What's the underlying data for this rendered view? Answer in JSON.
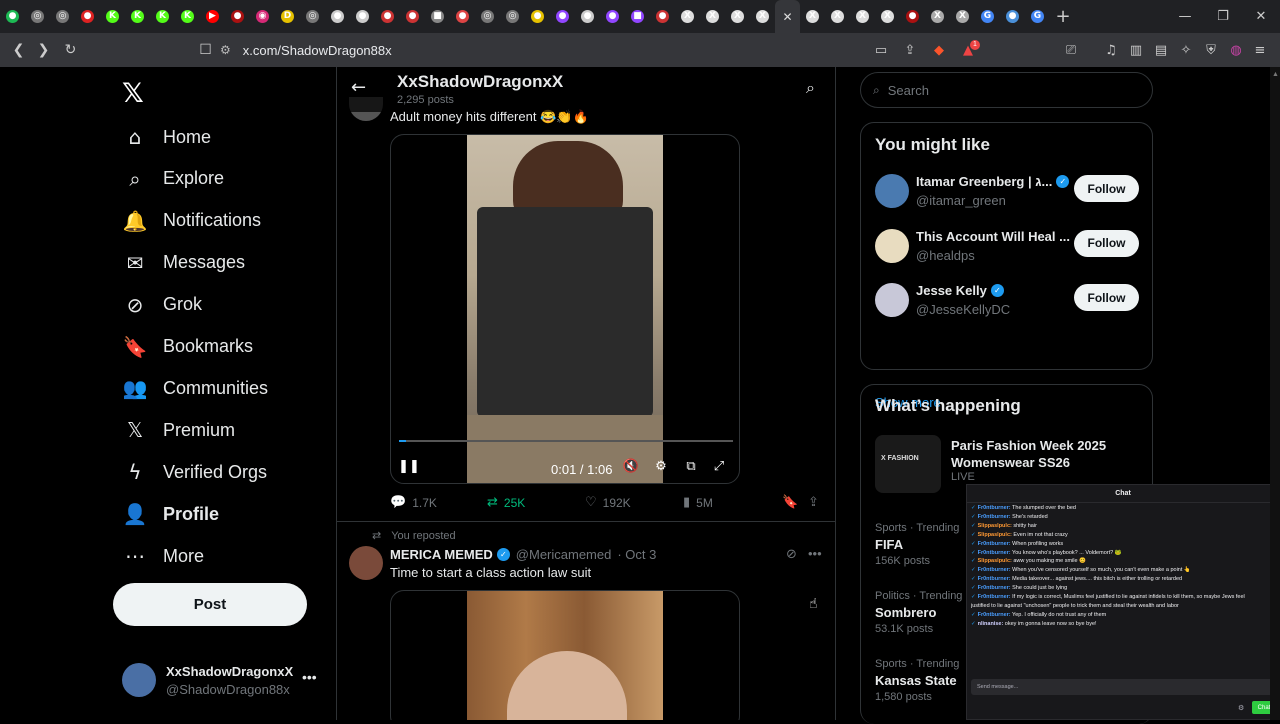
{
  "browser": {
    "tabs": [
      {
        "icon": "green-circle",
        "color": "#1db954",
        "glyph": "●"
      },
      {
        "icon": "grey-circle",
        "color": "#777",
        "glyph": "◎"
      },
      {
        "icon": "grey-circle",
        "color": "#777",
        "glyph": "◎"
      },
      {
        "icon": "red-circle",
        "color": "#d22",
        "glyph": "●"
      },
      {
        "icon": "kick-logo",
        "color": "#53fc18",
        "glyph": "K"
      },
      {
        "icon": "kick-logo",
        "color": "#53fc18",
        "glyph": "K"
      },
      {
        "icon": "kick-logo",
        "color": "#53fc18",
        "glyph": "K"
      },
      {
        "icon": "kick-logo",
        "color": "#53fc18",
        "glyph": "K"
      },
      {
        "icon": "youtube-logo",
        "color": "#f00",
        "glyph": "▶"
      },
      {
        "icon": "red-circle",
        "color": "#a11",
        "glyph": "●"
      },
      {
        "icon": "instagram-logo",
        "color": "#d62976",
        "glyph": "◉"
      },
      {
        "icon": "yellow-d-logo",
        "color": "#e5c100",
        "glyph": "D"
      },
      {
        "icon": "grey-circle",
        "color": "#777",
        "glyph": "◎"
      },
      {
        "icon": "white-circle",
        "color": "#ccc",
        "glyph": "●"
      },
      {
        "icon": "white-circle",
        "color": "#ccc",
        "glyph": "●"
      },
      {
        "icon": "red-circle",
        "color": "#c33",
        "glyph": "●"
      },
      {
        "icon": "red-circle",
        "color": "#c33",
        "glyph": "●"
      },
      {
        "icon": "grey-square",
        "color": "#888",
        "glyph": "■"
      },
      {
        "icon": "red-circle",
        "color": "#d44",
        "glyph": "●"
      },
      {
        "icon": "grey-circle",
        "color": "#777",
        "glyph": "◎"
      },
      {
        "icon": "grey-circle",
        "color": "#777",
        "glyph": "◎"
      },
      {
        "icon": "yellow-circle",
        "color": "#e5c100",
        "glyph": "●"
      },
      {
        "icon": "purple-circle",
        "color": "#9146ff",
        "glyph": "●"
      },
      {
        "icon": "white-circle",
        "color": "#ccc",
        "glyph": "●"
      },
      {
        "icon": "purple-circle",
        "color": "#9146ff",
        "glyph": "●"
      },
      {
        "icon": "twitch-logo",
        "color": "#9146ff",
        "glyph": "■"
      },
      {
        "icon": "red-circle",
        "color": "#c33",
        "glyph": "●"
      },
      {
        "icon": "x-logo",
        "color": "#ddd",
        "glyph": "X"
      },
      {
        "icon": "x-logo",
        "color": "#ddd",
        "glyph": "X"
      },
      {
        "icon": "x-logo",
        "color": "#ddd",
        "glyph": "X"
      },
      {
        "icon": "x-logo",
        "color": "#ddd",
        "glyph": "X"
      },
      {
        "icon": "close-icon",
        "color": "#ddd",
        "glyph": "✕",
        "active": true
      },
      {
        "icon": "x-logo",
        "color": "#ddd",
        "glyph": "X"
      },
      {
        "icon": "x-logo",
        "color": "#ddd",
        "glyph": "X"
      },
      {
        "icon": "x-logo",
        "color": "#ddd",
        "glyph": "X"
      },
      {
        "icon": "x-logo",
        "color": "#ddd",
        "glyph": "X"
      },
      {
        "icon": "red-circle",
        "color": "#a11",
        "glyph": "●"
      },
      {
        "icon": "x-logo",
        "color": "#aaa",
        "glyph": "X"
      },
      {
        "icon": "x-logo",
        "color": "#aaa",
        "glyph": "X"
      },
      {
        "icon": "google-logo",
        "color": "#4285f4",
        "glyph": "G"
      },
      {
        "icon": "blue-circle",
        "color": "#4a90d9",
        "glyph": "●"
      },
      {
        "icon": "google-logo",
        "color": "#4285f4",
        "glyph": "G"
      }
    ],
    "url": "x.com/ShadowDragon88x",
    "extension_badge": "1"
  },
  "nav": {
    "items": [
      {
        "label": "Home",
        "icon": "home-icon",
        "glyph": "⌂"
      },
      {
        "label": "Explore",
        "icon": "search-icon",
        "glyph": "⌕"
      },
      {
        "label": "Notifications",
        "icon": "bell-icon",
        "glyph": "🔔"
      },
      {
        "label": "Messages",
        "icon": "mail-icon",
        "glyph": "✉"
      },
      {
        "label": "Grok",
        "icon": "grok-icon",
        "glyph": "⊘"
      },
      {
        "label": "Bookmarks",
        "icon": "bookmark-icon",
        "glyph": "🔖"
      },
      {
        "label": "Communities",
        "icon": "people-icon",
        "glyph": "👥"
      },
      {
        "label": "Premium",
        "icon": "x-logo-icon",
        "glyph": "𝕏"
      },
      {
        "label": "Verified Orgs",
        "icon": "lightning-icon",
        "glyph": "ϟ"
      },
      {
        "label": "Profile",
        "icon": "person-icon",
        "glyph": "👤",
        "bold": true
      },
      {
        "label": "More",
        "icon": "more-circle-icon",
        "glyph": "⋯"
      }
    ],
    "post_label": "Post",
    "account": {
      "name": "XxShadowDragonxX",
      "handle": "@ShadowDragon88x"
    }
  },
  "header": {
    "title": "XxShadowDragonxX",
    "subtitle": "2,295 posts"
  },
  "tweet1": {
    "text": "Adult money hits different 😂👏🔥",
    "video_time": "0:01 / 1:06",
    "video_progress": 0.02,
    "replies": "1.7K",
    "reposts": "25K",
    "likes": "192K",
    "views": "5M"
  },
  "tweet2": {
    "repost_label": "You reposted",
    "name": "MERICA MEMED",
    "handle": "@Mericamemed",
    "date": "· Oct 3",
    "text": "Time to start a class action law suit"
  },
  "right": {
    "search_placeholder": "Search",
    "might_like_title": "You might like",
    "suggestions": [
      {
        "name": "Itamar Greenberg | ג...",
        "handle": "@itamar_green",
        "verified": true,
        "follow": "Follow",
        "color": "#4a7ab0"
      },
      {
        "name": "This Account Will Heal ...",
        "handle": "@healdps",
        "verified": false,
        "follow": "Follow",
        "color": "#e8dcc0"
      },
      {
        "name": "Jesse Kelly",
        "handle": "@JesseKellyDC",
        "verified": true,
        "follow": "Follow",
        "color": "#c8c8d8"
      }
    ],
    "show_more": "Show more",
    "happening_title": "What’s happening",
    "live_event": {
      "title": "Paris Fashion Week 2025 Womenswear SS26",
      "status": "LIVE",
      "image_label": "X FASHION"
    },
    "trends": [
      {
        "category": "Sports · Trending",
        "title": "FIFA",
        "count": "156K posts"
      },
      {
        "category": "Politics · Trending",
        "title": "Sombrero",
        "count": "53.1K posts"
      },
      {
        "category": "Sports · Trending",
        "title": "Kansas State",
        "count": "1,580 posts"
      }
    ]
  },
  "chat": {
    "title": "Chat",
    "messages": [
      {
        "user": "Fr0ntburner:",
        "color": "#4a9eff",
        "text": " The slumped over the bed"
      },
      {
        "user": "Fr0ntburner:",
        "color": "#4a9eff",
        "text": " She's retarded"
      },
      {
        "user": "Slippaslpulc:",
        "color": "#ff9933",
        "text": " shitty hair"
      },
      {
        "user": "Slippaslpulc:",
        "color": "#ff9933",
        "text": " Even im not that crazy"
      },
      {
        "user": "Fr0ntburner:",
        "color": "#4a9eff",
        "text": " When profiling works"
      },
      {
        "user": "Fr0ntburner:",
        "color": "#4a9eff",
        "text": " You know who's playbook? ... Voldemort? 🐸"
      },
      {
        "user": "Slippaslpulc:",
        "color": "#ff9933",
        "text": " aww you making me smile 😊"
      },
      {
        "user": "Fr0ntburner:",
        "color": "#4a9eff",
        "text": " When you've censored yourself so much, you can't even make a point 👆"
      },
      {
        "user": "Fr0ntburner:",
        "color": "#4a9eff",
        "text": " Media takeover... against jews.... this bitch is either trolling or retarded"
      },
      {
        "user": "Fr0ntburner:",
        "color": "#4a9eff",
        "text": " She could just be lying"
      },
      {
        "user": "Fr0ntburner:",
        "color": "#4a9eff",
        "text": " If my logic is correct, Muslims feel justified to lie against infidels to kill them, so maybe Jews feel"
      },
      {
        "user": "",
        "color": "#efeff1",
        "text": "justified to lie against \"unchosen\" people to trick them and steal their wealth and labor"
      },
      {
        "user": "Fr0ntburner:",
        "color": "#4a9eff",
        "text": " Yep. I officially do not trust any of them"
      },
      {
        "user": "nlinanise:",
        "color": "#d0d0ff",
        "text": " okey im gonna leave now so bye bye!"
      }
    ],
    "input_placeholder": "Send message...",
    "send_label": "Chat"
  }
}
